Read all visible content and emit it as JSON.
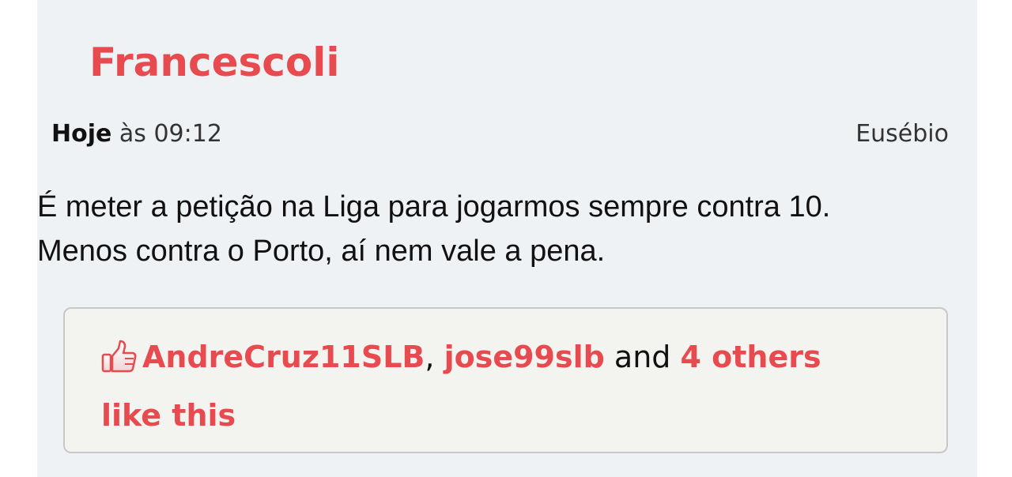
{
  "post": {
    "author": "Francescoli",
    "date_bold": "Hoje",
    "date_rest": " às 09:12",
    "role": "Eusébio",
    "message_line1": "É meter a petição na Liga para jogarmos sempre contra 10.",
    "message_line2": "Menos contra o Porto, aí nem vale a pena."
  },
  "likes": {
    "icon": "thumbs-up-icon",
    "user1": "AndreCruz11SLB",
    "separator": ", ",
    "user2": "jose99slb",
    "and_text": " and ",
    "others": "4 others like this"
  },
  "colors": {
    "accent": "#e74a4f",
    "background": "#eff2f5",
    "likes_box_bg": "#f3f3ef",
    "likes_box_border": "#c8c8c8"
  }
}
